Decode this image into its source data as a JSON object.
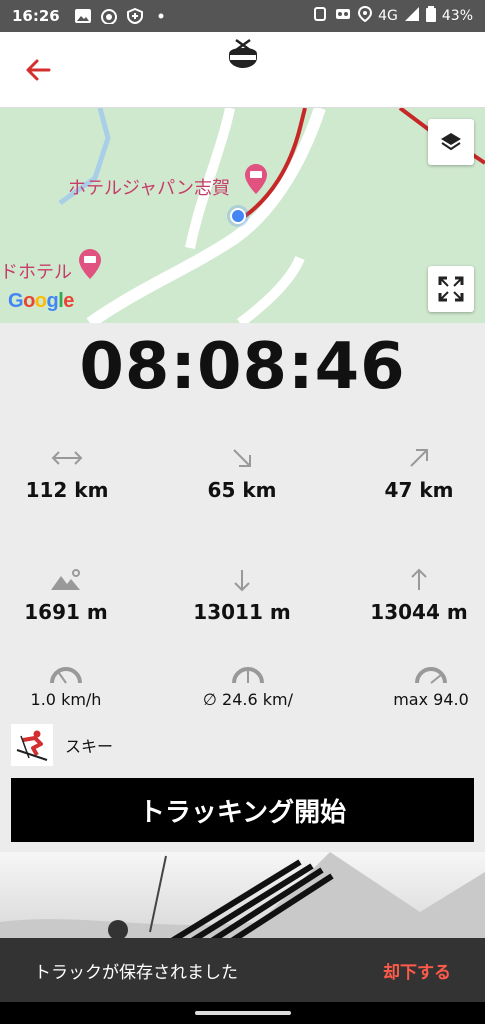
{
  "status_bar": {
    "time": "16:26",
    "network": "4G",
    "battery": "43%"
  },
  "map": {
    "label_hotel_1": "ホテルジャパン志賀",
    "label_hotel_2": "ドホテル",
    "google_letters": [
      "G",
      "o",
      "o",
      "g",
      "l",
      "e"
    ],
    "google_colors": [
      "#4285F4",
      "#EA4335",
      "#FBBC05",
      "#4285F4",
      "#34A853",
      "#EA4335"
    ]
  },
  "timer": "08:08:46",
  "stats": {
    "distance": "112 km",
    "downhill_distance": "65 km",
    "uphill_distance": "47 km",
    "altitude": "1691 m",
    "descent": "13011 m",
    "ascent": "13044 m",
    "speed": "1.0 km/h",
    "avg_speed": "∅ 24.6 km/",
    "max_speed": "max 94.0"
  },
  "sport": {
    "label": "スキー"
  },
  "track_button": "トラッキング開始",
  "snackbar": {
    "message": "トラックが保存されました",
    "action": "却下する"
  },
  "colors": {
    "accent": "#d32f2f",
    "map_green": "#cfe9cf"
  }
}
